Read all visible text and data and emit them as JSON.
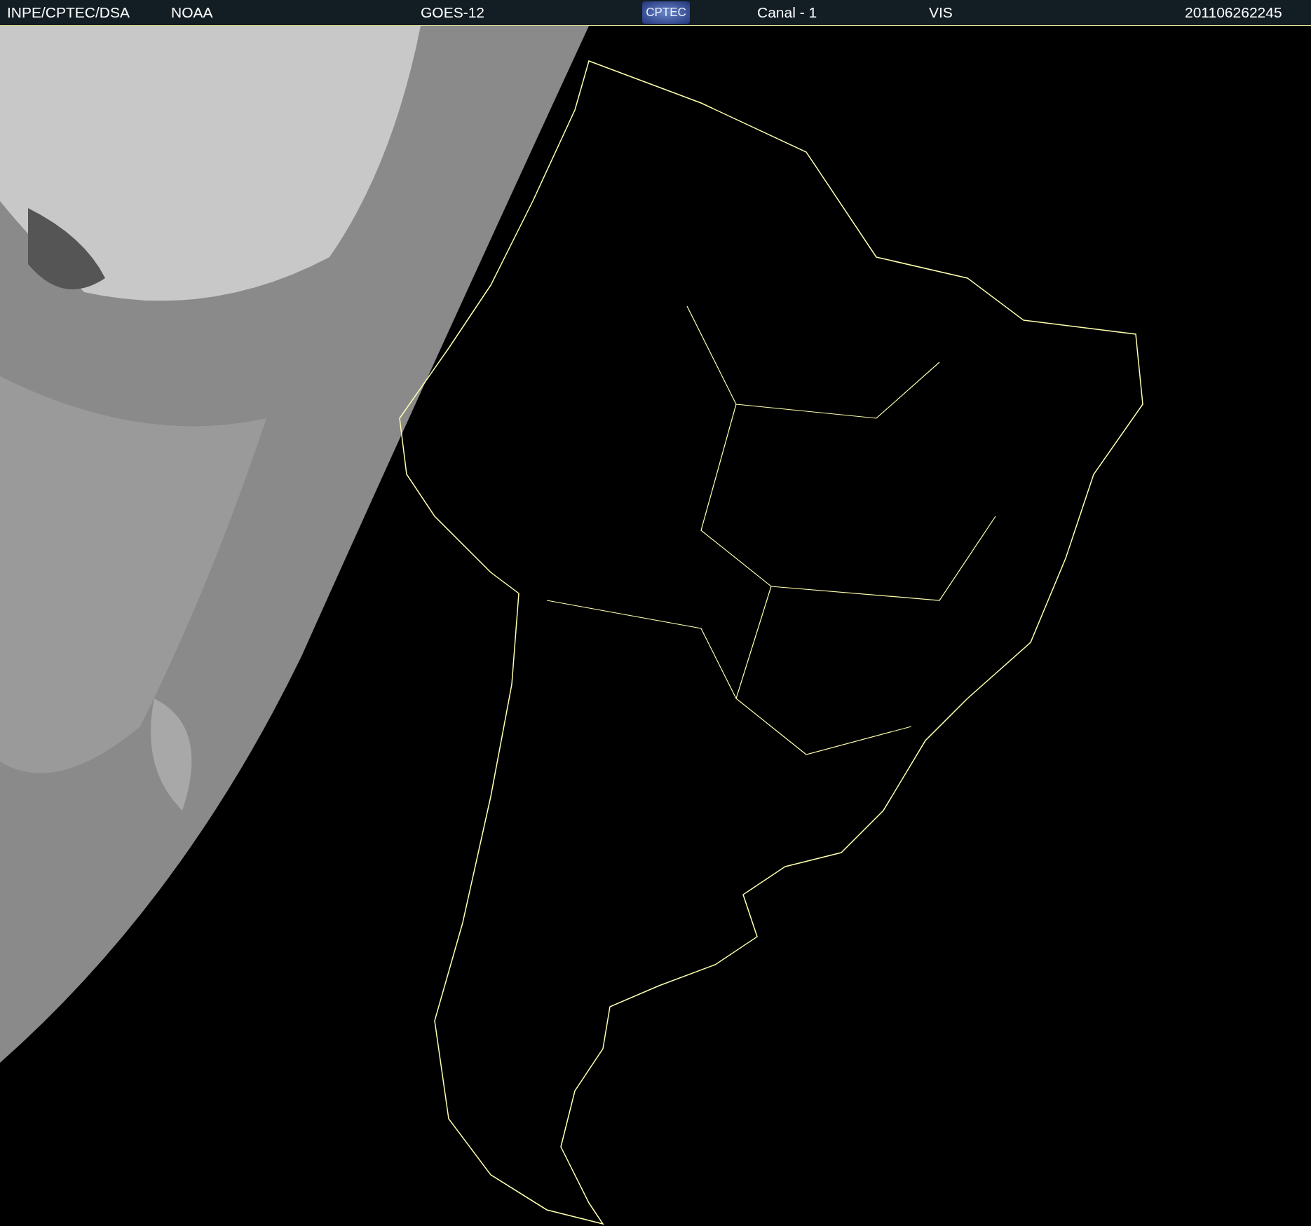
{
  "header": {
    "agency": "INPE/CPTEC/DSA",
    "source": "NOAA",
    "satellite": "GOES-12",
    "logo_text": "CPTEC",
    "channel": "Canal - 1",
    "band": "VIS",
    "timestamp": "201106262245"
  }
}
